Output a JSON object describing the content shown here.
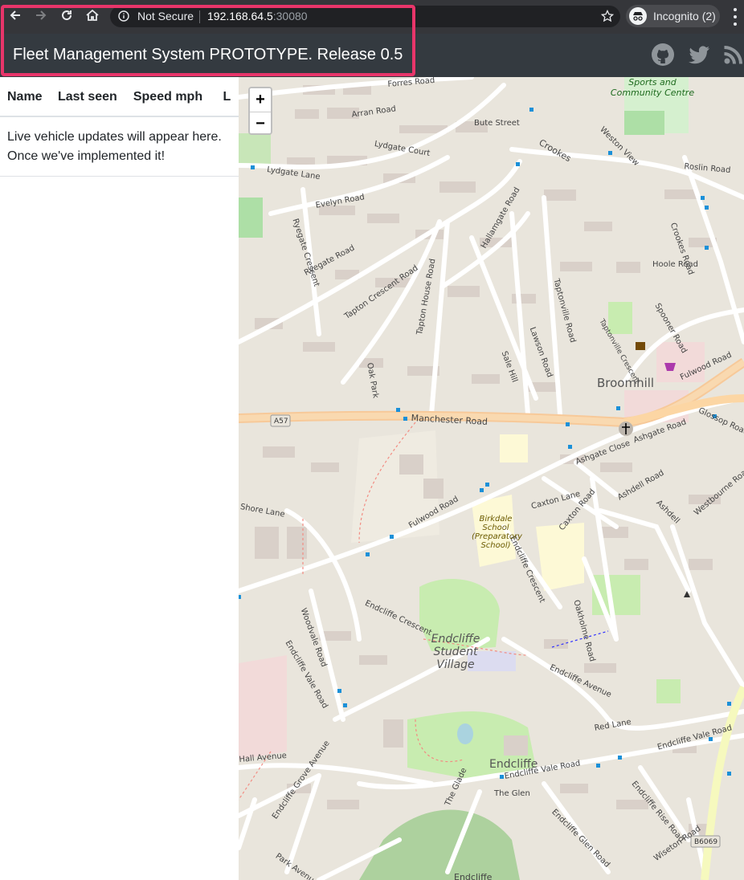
{
  "browser": {
    "security_label": "Not Secure",
    "url_host": "192.168.64.5",
    "url_port": ":30080",
    "incognito_label": "Incognito (2)"
  },
  "app": {
    "title": "Fleet Management System PROTOTYPE. Release 0.5",
    "header_icons": [
      "github-icon",
      "twitter-icon",
      "rss-icon"
    ]
  },
  "table": {
    "headers": [
      "Name",
      "Last seen",
      "Speed mph",
      "L"
    ],
    "empty_message": "Live vehicle updates will appear here. Once we've implemented it!"
  },
  "map": {
    "zoom_in": "+",
    "zoom_out": "−",
    "labels": {
      "forres": "Forres Road",
      "arran": "Arran Road",
      "bute": "Bute Street",
      "lydgate_court": "Lydgate Court",
      "lydgate_lane": "Lydgate Lane",
      "evelyn": "Evelyn Road",
      "ryegate_cres": "Ryegate Crescent",
      "ryegate_road": "Ryegate Road",
      "tapton_cres": "Tapton Crescent Road",
      "tapton_house": "Tapton House Road",
      "hallamgate": "Hallamgate Road",
      "taptonville": "Taptonville Road",
      "taptonville_cres": "Taptonville Crescent",
      "lawson": "Lawson Road",
      "sale_hill": "Sale Hill",
      "oak_park": "Oak Park",
      "crookes": "Crookes",
      "crookes_road": "Crookes Road",
      "weston_view": "Weston View",
      "roslin": "Roslin Road",
      "hoole": "Hoole Road",
      "spooner": "Spooner Road",
      "sports_centre": "Sports and Community Centre",
      "broomhill": "Broomhill",
      "fulwood_road": "Fulwood Road",
      "glossop": "Glossop Road",
      "a57": "A57",
      "manchester": "Manchester Road",
      "ashgate_close": "Ashgate Close",
      "ashgate_road": "Ashgate Road",
      "ashdell_road": "Ashdell Road",
      "ashdell": "Ashdell",
      "westbourne": "Westbourne Road",
      "shore_lane": "Shore Lane",
      "fulwood_road2": "Fulwood Road",
      "caxton_lane": "Caxton Lane",
      "caxton_road": "Caxton Road",
      "birkdale": "Birkdale School (Preparatory School)",
      "endcliffe_cres": "Endcliffe Crescent",
      "endcliffe_cres2": "Endcliffe Crescent",
      "oakholme": "Oakholme Road",
      "woodvale": "Woodvale Road",
      "endcliffe_vale": "Endcliffe Vale Road",
      "student_village": "Endcliffe Student Village",
      "endcliffe_ave": "Endcliffe Avenue",
      "red_lane": "Red Lane",
      "endcliffe_vale_road2": "Endcliffe Vale Road",
      "endcliffe": "Endcliffe",
      "endcliffe_vale3": "Endcliffe Vale Road",
      "the_glen": "The Glen",
      "the_glade": "The Glade",
      "endcliffe_glen": "Endcliffe Glen Road",
      "endcliffe_rise": "Endcliffe Rise Road",
      "endcliffe_grove": "Endcliffe Grove Avenue",
      "park_avenue": "Park Avenue",
      "hall_avenue": "Hall Avenue",
      "b6069": "B6069",
      "wiseton": "Wiseton Road",
      "endcliffe_park": "Endcliffe"
    }
  }
}
